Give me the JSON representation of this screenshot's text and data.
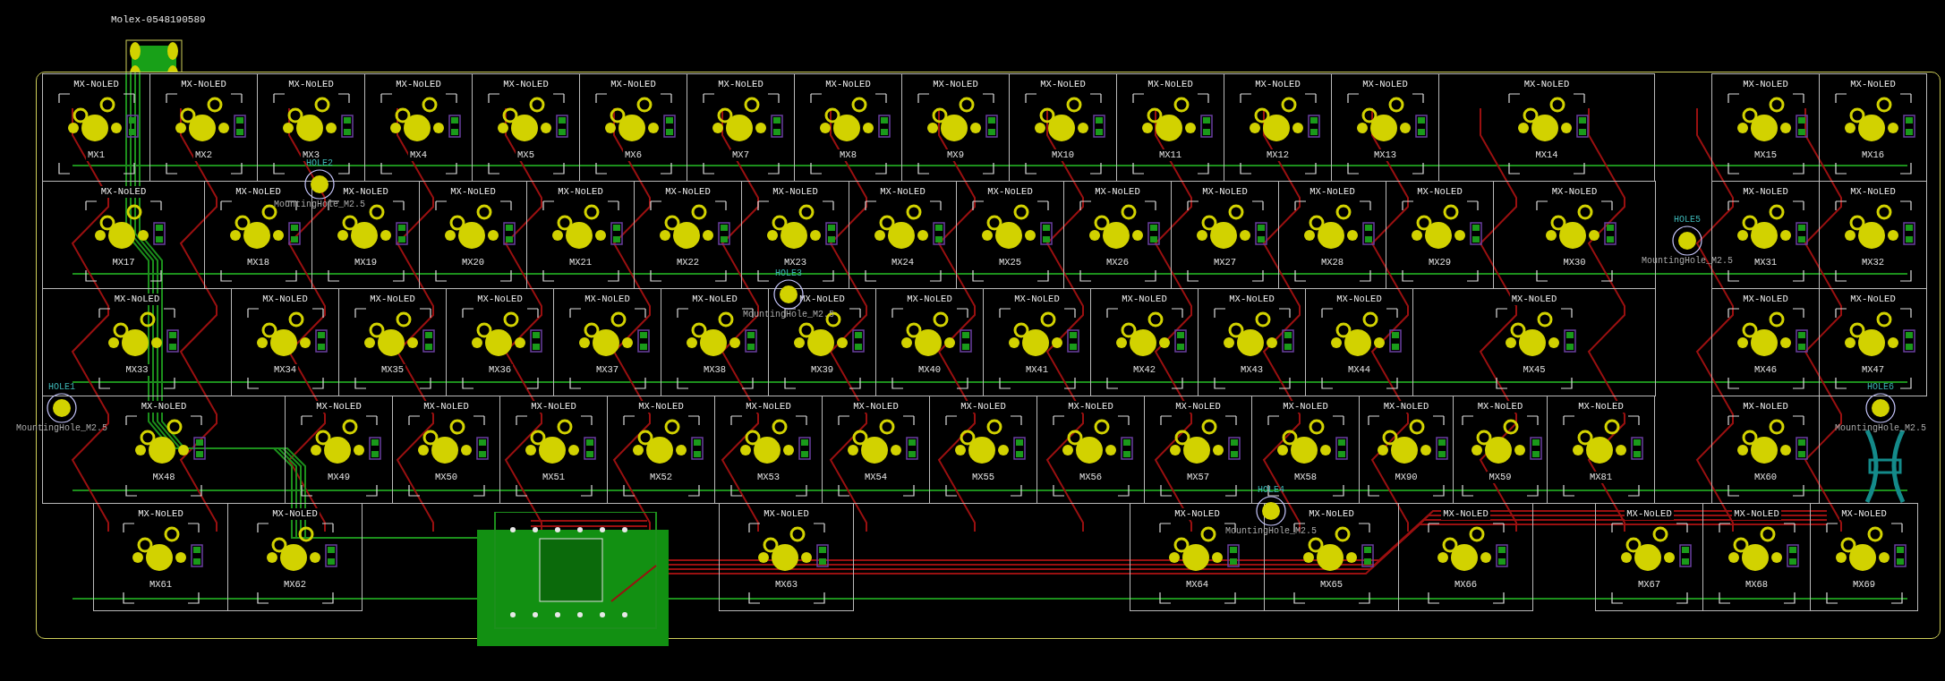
{
  "connector": {
    "label": "Molex-0548190589"
  },
  "rows": [
    {
      "clusters": [
        [
          {
            "ref": "MX1",
            "footprint": "MX-NoLED",
            "kind": "unit"
          },
          {
            "ref": "MX2",
            "footprint": "MX-NoLED",
            "kind": "unit"
          },
          {
            "ref": "MX3",
            "footprint": "MX-NoLED",
            "kind": "unit"
          },
          {
            "ref": "MX4",
            "footprint": "MX-NoLED",
            "kind": "unit"
          },
          {
            "ref": "MX5",
            "footprint": "MX-NoLED",
            "kind": "unit"
          },
          {
            "ref": "MX6",
            "footprint": "MX-NoLED",
            "kind": "unit"
          },
          {
            "ref": "MX7",
            "footprint": "MX-NoLED",
            "kind": "unit"
          },
          {
            "ref": "MX8",
            "footprint": "MX-NoLED",
            "kind": "unit"
          },
          {
            "ref": "MX9",
            "footprint": "MX-NoLED",
            "kind": "unit"
          },
          {
            "ref": "MX10",
            "footprint": "MX-NoLED",
            "kind": "unit"
          },
          {
            "ref": "MX11",
            "footprint": "MX-NoLED",
            "kind": "unit"
          },
          {
            "ref": "MX12",
            "footprint": "MX-NoLED",
            "kind": "unit"
          },
          {
            "ref": "MX13",
            "footprint": "MX-NoLED",
            "kind": "unit"
          },
          {
            "ref": "MX14",
            "footprint": "MX-NoLED",
            "kind": "double"
          }
        ],
        [
          {
            "ref": "MX15",
            "footprint": "MX-NoLED",
            "kind": "unit"
          },
          {
            "ref": "MX16",
            "footprint": "MX-NoLED",
            "kind": "unit"
          }
        ]
      ]
    },
    {
      "clusters": [
        [
          {
            "ref": "MX17",
            "footprint": "MX-NoLED",
            "kind": "wider"
          },
          {
            "ref": "MX18",
            "footprint": "MX-NoLED",
            "kind": "unit"
          },
          {
            "ref": "MX19",
            "footprint": "MX-NoLED",
            "kind": "unit"
          },
          {
            "ref": "MX20",
            "footprint": "MX-NoLED",
            "kind": "unit"
          },
          {
            "ref": "MX21",
            "footprint": "MX-NoLED",
            "kind": "unit"
          },
          {
            "ref": "MX22",
            "footprint": "MX-NoLED",
            "kind": "unit"
          },
          {
            "ref": "MX23",
            "footprint": "MX-NoLED",
            "kind": "unit"
          },
          {
            "ref": "MX24",
            "footprint": "MX-NoLED",
            "kind": "unit"
          },
          {
            "ref": "MX25",
            "footprint": "MX-NoLED",
            "kind": "unit"
          },
          {
            "ref": "MX26",
            "footprint": "MX-NoLED",
            "kind": "unit"
          },
          {
            "ref": "MX27",
            "footprint": "MX-NoLED",
            "kind": "unit"
          },
          {
            "ref": "MX28",
            "footprint": "MX-NoLED",
            "kind": "unit"
          },
          {
            "ref": "MX29",
            "footprint": "MX-NoLED",
            "kind": "unit"
          },
          {
            "ref": "MX30",
            "footprint": "MX-NoLED",
            "kind": "wider"
          }
        ],
        [
          {
            "ref": "MX31",
            "footprint": "MX-NoLED",
            "kind": "unit"
          },
          {
            "ref": "MX32",
            "footprint": "MX-NoLED",
            "kind": "unit"
          }
        ]
      ]
    },
    {
      "clusters": [
        [
          {
            "ref": "MX33",
            "footprint": "MX-NoLED",
            "kind": "broad"
          },
          {
            "ref": "MX34",
            "footprint": "MX-NoLED",
            "kind": "unit"
          },
          {
            "ref": "MX35",
            "footprint": "MX-NoLED",
            "kind": "unit"
          },
          {
            "ref": "MX36",
            "footprint": "MX-NoLED",
            "kind": "unit"
          },
          {
            "ref": "MX37",
            "footprint": "MX-NoLED",
            "kind": "unit"
          },
          {
            "ref": "MX38",
            "footprint": "MX-NoLED",
            "kind": "unit"
          },
          {
            "ref": "MX39",
            "footprint": "MX-NoLED",
            "kind": "unit"
          },
          {
            "ref": "MX40",
            "footprint": "MX-NoLED",
            "kind": "unit"
          },
          {
            "ref": "MX41",
            "footprint": "MX-NoLED",
            "kind": "unit"
          },
          {
            "ref": "MX42",
            "footprint": "MX-NoLED",
            "kind": "unit"
          },
          {
            "ref": "MX43",
            "footprint": "MX-NoLED",
            "kind": "unit"
          },
          {
            "ref": "MX44",
            "footprint": "MX-NoLED",
            "kind": "unit"
          },
          {
            "ref": "MX45",
            "footprint": "MX-NoLED",
            "kind": "widest"
          }
        ],
        [
          {
            "ref": "MX46",
            "footprint": "MX-NoLED",
            "kind": "unit"
          },
          {
            "ref": "MX47",
            "footprint": "MX-NoLED",
            "kind": "unit"
          }
        ]
      ]
    },
    {
      "clusters": [
        [
          {
            "ref": "MX48",
            "footprint": "MX-NoLED",
            "kind": "widest"
          },
          {
            "ref": "MX49",
            "footprint": "MX-NoLED",
            "kind": "unit"
          },
          {
            "ref": "MX50",
            "footprint": "MX-NoLED",
            "kind": "unit"
          },
          {
            "ref": "MX51",
            "footprint": "MX-NoLED",
            "kind": "unit"
          },
          {
            "ref": "MX52",
            "footprint": "MX-NoLED",
            "kind": "unit"
          },
          {
            "ref": "MX53",
            "footprint": "MX-NoLED",
            "kind": "unit"
          },
          {
            "ref": "MX54",
            "footprint": "MX-NoLED",
            "kind": "unit"
          },
          {
            "ref": "MX55",
            "footprint": "MX-NoLED",
            "kind": "unit"
          },
          {
            "ref": "MX56",
            "footprint": "MX-NoLED",
            "kind": "unit"
          },
          {
            "ref": "MX57",
            "footprint": "MX-NoLED",
            "kind": "unit"
          },
          {
            "ref": "MX58",
            "footprint": "MX-NoLED",
            "kind": "unit"
          },
          {
            "ref": "MX90",
            "footprint": "MX-NoLED",
            "kind": "narrow"
          },
          {
            "ref": "MX59",
            "footprint": "MX-NoLED",
            "kind": "narrow"
          },
          {
            "ref": "MX81",
            "footprint": "MX-NoLED",
            "kind": "unit"
          }
        ],
        [
          {
            "ref": "MX60",
            "footprint": "MX-NoLED",
            "kind": "unit"
          }
        ]
      ]
    },
    {
      "clusters": [
        [
          {
            "ref": "MX61",
            "footprint": "MX-NoLED",
            "kind": "wide"
          },
          {
            "ref": "MX62",
            "footprint": "MX-NoLED",
            "kind": "wide"
          }
        ],
        [
          {
            "ref": "MX63",
            "footprint": "MX-NoLED",
            "kind": "wide"
          }
        ],
        [
          {
            "ref": "MX64",
            "footprint": "MX-NoLED",
            "kind": "wide"
          },
          {
            "ref": "MX65",
            "footprint": "MX-NoLED",
            "kind": "wide"
          },
          {
            "ref": "MX66",
            "footprint": "MX-NoLED",
            "kind": "wide"
          }
        ],
        [
          {
            "ref": "MX67",
            "footprint": "MX-NoLED",
            "kind": "unit"
          },
          {
            "ref": "MX68",
            "footprint": "MX-NoLED",
            "kind": "unit"
          },
          {
            "ref": "MX69",
            "footprint": "MX-NoLED",
            "kind": "unit"
          }
        ]
      ]
    }
  ],
  "holes": [
    {
      "ref": "HOLE1",
      "value": "MountingHole_M2.5"
    },
    {
      "ref": "HOLE2",
      "value": "MountingHole_M2.5"
    },
    {
      "ref": "HOLE3",
      "value": "MountingHole_M2.5"
    },
    {
      "ref": "HOLE4",
      "value": "MountingHole_M2.5"
    },
    {
      "ref": "HOLE5",
      "value": "MountingHole_M2.5"
    },
    {
      "ref": "HOLE6",
      "value": "MountingHole_M2.5"
    }
  ]
}
